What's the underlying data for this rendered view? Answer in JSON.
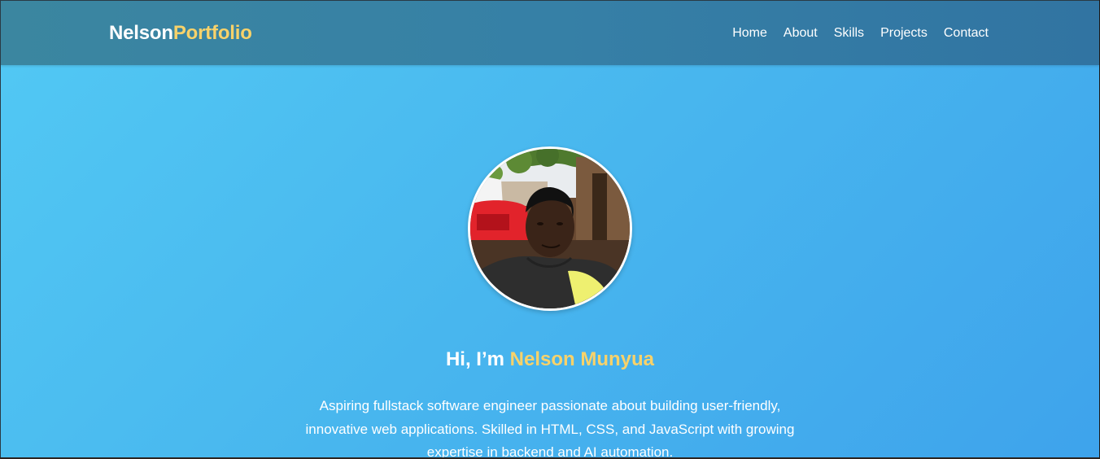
{
  "navbar": {
    "brand_first": "Nelson",
    "brand_second": "Portfolio",
    "links": [
      "Home",
      "About",
      "Skills",
      "Projects",
      "Contact"
    ]
  },
  "hero": {
    "avatar_alt": "Profile photo",
    "greeting_prefix": "Hi, I’m ",
    "name": "Nelson Munyua",
    "bio": "Aspiring fullstack software engineer passionate about building user-friendly, innovative web applications. Skilled in HTML, CSS, and JavaScript with growing expertise in backend and AI automation."
  },
  "colors": {
    "accent": "#f8d26a",
    "navbar": "#3680a6",
    "hero_gradient_start": "#52c9f4",
    "hero_gradient_end": "#3ea3ec"
  }
}
